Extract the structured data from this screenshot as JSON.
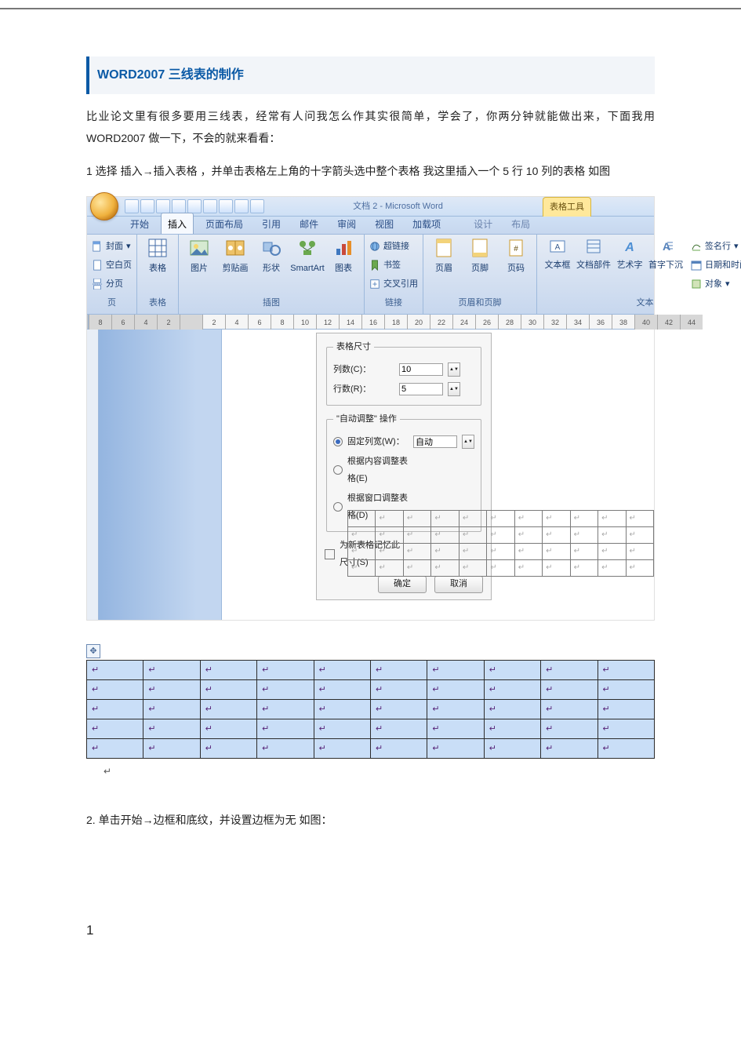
{
  "document": {
    "titlebar": "WORD2007 三线表的制作",
    "intro": "比业论文里有很多要用三线表，经常有人问我怎么作其实很简单，学会了，你两分钟就能做出来，下面我用WORD2007 做一下，不会的就来看看：",
    "step1": "1 选择 插入→插入表格 ，并单击表格左上角的十字箭头选中整个表格  我这里插入一个 5 行 10 列的表格 如图",
    "step2": "2. 单击开始→边框和底纹，并设置边框为无  如图：",
    "page_number": "1",
    "tail_mark": "↵"
  },
  "word": {
    "window_title": "文档 2 - Microsoft Word",
    "context_tab_group": "表格工具",
    "tabs": [
      "开始",
      "插入",
      "页面布局",
      "引用",
      "邮件",
      "审阅",
      "视图",
      "加载项",
      "设计",
      "布局"
    ],
    "active_tab_index": 1,
    "groups": {
      "pages": {
        "label": "页",
        "items": [
          "封面",
          "空白页",
          "分页"
        ]
      },
      "tables": {
        "label": "表格",
        "items": [
          "表格"
        ]
      },
      "illustrations": {
        "label": "插图",
        "items": [
          "图片",
          "剪贴画",
          "形状",
          "SmartArt",
          "图表"
        ]
      },
      "links": {
        "label": "链接",
        "items": [
          "超链接",
          "书签",
          "交叉引用"
        ]
      },
      "header_footer": {
        "label": "页眉和页脚",
        "items": [
          "页眉",
          "页脚",
          "页码"
        ]
      },
      "text": {
        "label": "文本",
        "items": [
          "文本框",
          "文档部件",
          "艺术字",
          "首字下沉"
        ],
        "right_items": [
          "签名行",
          "日期和时间",
          "对象"
        ]
      }
    },
    "ruler_labels": [
      "8",
      "6",
      "4",
      "2",
      "",
      "2",
      "4",
      "6",
      "8",
      "10",
      "12",
      "14",
      "16",
      "18",
      "20",
      "22",
      "24",
      "26",
      "28",
      "30",
      "32",
      "34",
      "36",
      "38",
      "40",
      "42",
      "44"
    ]
  },
  "dialog": {
    "size_legend": "表格尺寸",
    "columns_label": "列数(C)：",
    "rows_label": "行数(R)：",
    "columns_value": "10",
    "rows_value": "5",
    "auto_legend": "\"自动调整\" 操作",
    "opt_fixed": "固定列宽(W)：",
    "width_value": "自动",
    "opt_fit_content": "根据内容调整表格(E)",
    "opt_fit_window": "根据窗口调整表格(D)",
    "remember": "为新表格记忆此尺寸(S)",
    "ok": "确定",
    "cancel": "取消"
  },
  "mini_table": {
    "rows": 4,
    "cols": 11,
    "cell_mark": "↵"
  },
  "selected_table": {
    "rows": 5,
    "cols": 10,
    "cell_mark": "↵",
    "move_glyph": "✥"
  }
}
